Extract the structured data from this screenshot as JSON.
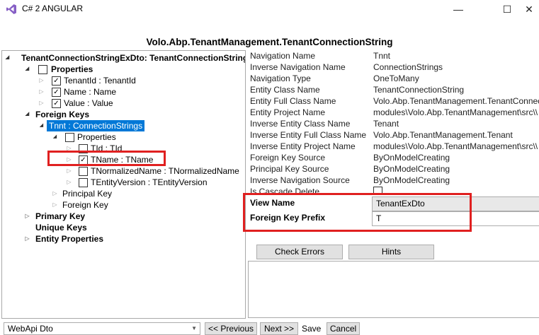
{
  "window": {
    "title": "C# 2 ANGULAR",
    "min_glyph": "—",
    "max_glyph": "☐",
    "close_glyph": "✕"
  },
  "panel_title": "Volo.Abp.TenantManagement.TenantConnectionString",
  "tree": {
    "root": "TenantConnectionStringExDto: TenantConnectionString",
    "properties_label": "Properties",
    "props": [
      "TenantId : TenantId",
      "Name : Name",
      "Value : Value"
    ],
    "foreign_keys_label": "Foreign Keys",
    "fk_selected": "Tnnt : ConnectionStrings",
    "fk_properties_label": "Properties",
    "fk_props": [
      "TId : TId",
      "TName : TName",
      "TNormalizedName : TNormalizedName",
      "TEntityVersion : TEntityVersion"
    ],
    "principal_key": "Principal Key",
    "foreign_key": "Foreign Key",
    "primary_key": "Primary Key",
    "unique_keys": "Unique Keys",
    "entity_properties": "Entity Properties"
  },
  "properties": [
    {
      "name": "Navigation Name",
      "value": "Tnnt"
    },
    {
      "name": "Inverse Navigation Name",
      "value": "ConnectionStrings"
    },
    {
      "name": "Navigation Type",
      "value": "OneToMany"
    },
    {
      "name": "Entity Class Name",
      "value": "TenantConnectionString"
    },
    {
      "name": "Entity Full Class Name",
      "value": "Volo.Abp.TenantManagement.TenantConnec"
    },
    {
      "name": "Entity Project Name",
      "value": "modules\\Volo.Abp.TenantManagement\\src\\\\"
    },
    {
      "name": "Inverse Entity Class Name",
      "value": "Tenant"
    },
    {
      "name": "Inverse Entity Full Class Name",
      "value": "Volo.Abp.TenantManagement.Tenant"
    },
    {
      "name": "Inverse Entity Project Name",
      "value": "modules\\Volo.Abp.TenantManagement\\src\\\\"
    },
    {
      "name": "Foreign Key Source",
      "value": "ByOnModelCreating"
    },
    {
      "name": "Principal Key Source",
      "value": "ByOnModelCreating"
    },
    {
      "name": "Inverse Navigation Source",
      "value": "ByOnModelCreating"
    },
    {
      "name": "Is Cascade Delete",
      "value": ""
    }
  ],
  "editable": {
    "view_name_label": "View Name",
    "view_name_value": "TenantExDto",
    "fk_prefix_label": "Foreign Key Prefix",
    "fk_prefix_value": "T"
  },
  "buttons": {
    "check_errors": "Check Errors",
    "hints": "Hints",
    "previous": "<< Previous",
    "next": "Next >>",
    "save": "Save",
    "cancel": "Cancel"
  },
  "template_select": "WebApi Dto",
  "colors": {
    "highlight": "#0078d7",
    "annotation": "#e02020",
    "vs_purple": "#865fc5"
  }
}
